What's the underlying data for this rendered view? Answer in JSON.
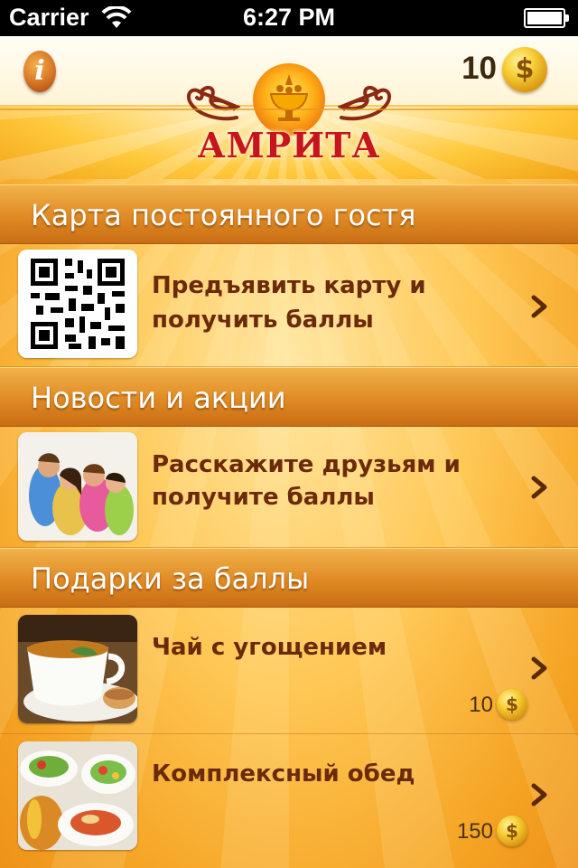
{
  "status_bar": {
    "carrier": "Carrier",
    "time": "6:27 PM"
  },
  "header": {
    "info_label": "i",
    "coin_count": "10",
    "coin_symbol": "$",
    "title": "АМРИТА"
  },
  "sections": [
    {
      "title": "Карта постоянного гостя",
      "item": {
        "line1": "Предъявить карту и",
        "line2": "получить баллы",
        "image": "qr-code"
      }
    },
    {
      "title": "Новости и акции",
      "item": {
        "line1": "Расскажите друзьям и",
        "line2": "получите баллы",
        "image": "friends-photo"
      }
    },
    {
      "title": "Подарки за баллы",
      "items": [
        {
          "title": "Чай с угощением",
          "price": "10",
          "image": "tea-photo"
        },
        {
          "title": "Комплексный обед",
          "price": "150",
          "image": "lunch-photo"
        }
      ]
    }
  ],
  "colors": {
    "section_header": "#df8a24",
    "item_text": "#6b2a0a",
    "title_red": "#c8141c"
  }
}
